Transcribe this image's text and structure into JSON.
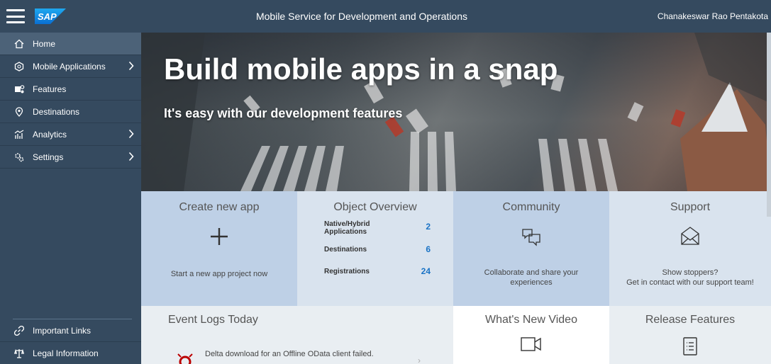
{
  "header": {
    "logo_text": "SAP",
    "title": "Mobile Service for Development and Operations",
    "user": "Chanakeswar Rao Pentakota"
  },
  "sidebar": {
    "items": [
      {
        "label": "Home",
        "icon": "home-icon",
        "active": true,
        "has_arrow": false
      },
      {
        "label": "Mobile Applications",
        "icon": "mobile-apps-icon",
        "active": false,
        "has_arrow": true
      },
      {
        "label": "Features",
        "icon": "features-icon",
        "active": false,
        "has_arrow": false
      },
      {
        "label": "Destinations",
        "icon": "location-icon",
        "active": false,
        "has_arrow": false
      },
      {
        "label": "Analytics",
        "icon": "analytics-icon",
        "active": false,
        "has_arrow": true
      },
      {
        "label": "Settings",
        "icon": "settings-icon",
        "active": false,
        "has_arrow": true
      }
    ],
    "bottom_items": [
      {
        "label": "Important Links",
        "icon": "link-icon"
      },
      {
        "label": "Legal Information",
        "icon": "legal-icon"
      }
    ]
  },
  "hero": {
    "title": "Build mobile apps in a snap",
    "subtitle": "It's easy with our development features"
  },
  "tiles": {
    "create_app": {
      "title": "Create new app",
      "description": "Start a new app project now"
    },
    "object_overview": {
      "title": "Object Overview",
      "rows": [
        {
          "label": "Native/Hybrid Applications",
          "count": "2"
        },
        {
          "label": "Destinations",
          "count": "6"
        },
        {
          "label": "Registrations",
          "count": "24"
        }
      ]
    },
    "community": {
      "title": "Community",
      "description": "Collaborate and share your experiences"
    },
    "support": {
      "title": "Support",
      "description_line1": "Show stoppers?",
      "description_line2": "Get in contact with our support team!"
    },
    "event_logs": {
      "title": "Event Logs Today",
      "entry": "Delta download for an Offline OData client failed.",
      "chevron": "›"
    },
    "whats_new": {
      "title": "What's New Video"
    },
    "release_features": {
      "title": "Release Features"
    }
  },
  "colors": {
    "shell": "#354a5f",
    "active_nav": "#4c6278",
    "tile_blue": "#bed0e6",
    "tile_light": "#d9e3ee",
    "count_blue": "#1a73c5",
    "error_red": "#bb0000"
  }
}
